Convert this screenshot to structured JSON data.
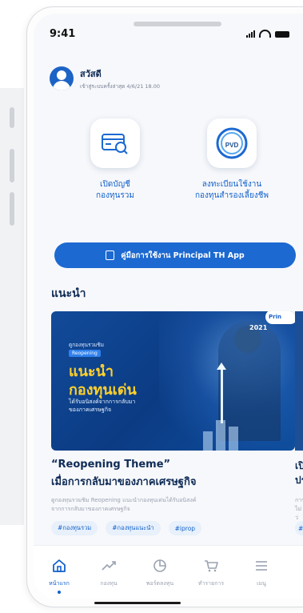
{
  "status": {
    "time": "9:41"
  },
  "greeting": {
    "name": "สวัสดี",
    "last_login": "เข้าสู่ระบบครั้งล่าสุด 4/6/21 18.00"
  },
  "services": [
    {
      "label_line1": "เปิดบัญชี",
      "label_line2": "กองทุนรวม",
      "icon": "card-search-icon"
    },
    {
      "label_line1": "ลงทะเบียนใช้งาน",
      "label_line2": "กองทุนสำรองเลี้ยงชีพ",
      "icon": "pvd-icon",
      "icon_text": "PVD"
    }
  ],
  "guide_button": {
    "label": "คู่มือการใช้งาน Principal TH App",
    "icon": "book-icon"
  },
  "section": {
    "title": "แนะนำ"
  },
  "featured_card": {
    "image": {
      "small_text": "ดูกองทุนรวมชิม",
      "tag": "Reopening",
      "headline1": "แนะนำ",
      "headline2": "กองทุนเด่น",
      "sub1": "ได้รับอนิสงค์จากการกลับมา",
      "sub2": "ของภาคเศรษฐกิจ",
      "year": "2021",
      "logo_text": "Prin"
    },
    "title_line1": "“Reopening Theme”",
    "title_line2": "เมื่อการกลับมาของภาคเศรษฐกิจ",
    "desc_line1": "ดูกองทุนรวมชิม Reopening แนะนำกองทุนเด่นได้รับอนิสงค์",
    "desc_line2": "จากการกลับมาของภาคเศรษฐกิจ",
    "tags": [
      "#กองทุนรวม",
      "#กองทุนแนะนำ",
      "#iprop"
    ]
  },
  "next_card": {
    "title_line1": "เปิ",
    "title_line2": "ปร",
    "desc_line1": "การ",
    "desc_line2": "ไม่ว่",
    "tag": "#"
  },
  "nav": [
    {
      "label": "หน้าแรก",
      "icon": "home-icon",
      "active": true
    },
    {
      "label": "กองทุน",
      "icon": "trend-icon",
      "active": false
    },
    {
      "label": "พอร์ตลงทุน",
      "icon": "pie-chart-icon",
      "active": false
    },
    {
      "label": "ทำรายการ",
      "icon": "cart-icon",
      "active": false
    },
    {
      "label": "เมนู",
      "icon": "menu-icon",
      "active": false
    }
  ],
  "colors": {
    "primary": "#1c69d1",
    "heading": "#0f2b56",
    "accent_yellow": "#ffd12b",
    "muted": "#9aa2b1"
  }
}
